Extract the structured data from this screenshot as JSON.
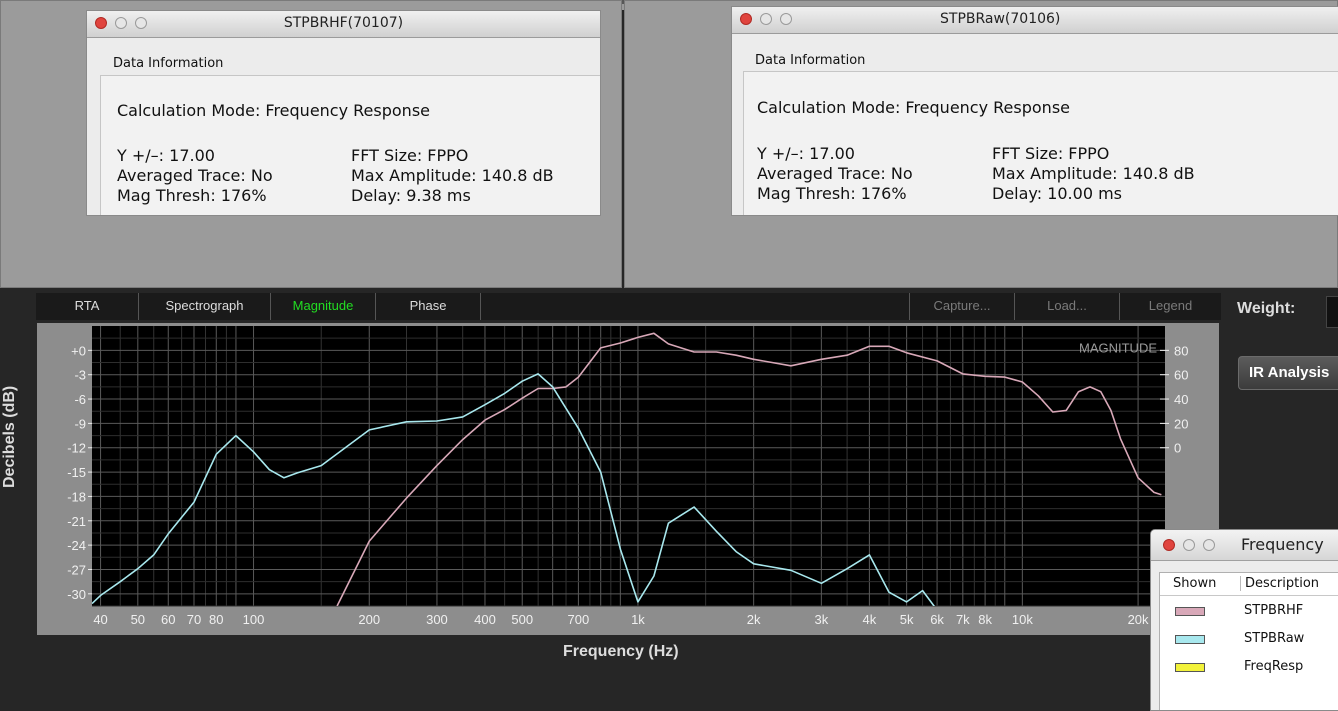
{
  "windows": [
    {
      "title": "STPBRHF(70107)",
      "info_heading": "Data Information",
      "calc_mode": "Calculation Mode: Frequency Response",
      "left_col": [
        "Y +/–: 17.00",
        "Averaged Trace: No",
        "Mag Thresh: 176%"
      ],
      "right_col": [
        "FFT Size: FPPO",
        "Max Amplitude: 140.8 dB",
        "Delay: 9.38 ms"
      ]
    },
    {
      "title": "STPBRaw(70106)",
      "info_heading": "Data Information",
      "calc_mode": "Calculation Mode: Frequency Response",
      "left_col": [
        "Y +/–: 17.00",
        "Averaged Trace: No",
        "Mag Thresh: 176%"
      ],
      "right_col": [
        "FFT Size: FPPO",
        "Max Amplitude: 140.8 dB",
        "Delay: 10.00 ms"
      ]
    }
  ],
  "tabs": [
    "RTA",
    "Spectrograph",
    "Magnitude",
    "Phase"
  ],
  "active_tab": "Magnitude",
  "right_buttons": [
    "Capture...",
    "Load...",
    "Legend"
  ],
  "weight_label": "Weight:",
  "ir_button": "IR Analysis",
  "chart_data": {
    "type": "line",
    "overlay_label": "MAGNITUDE",
    "xlabel": "Frequency (Hz)",
    "ylabel": "Decibels (dB)",
    "x_scale": "log",
    "xlim": [
      38,
      23500
    ],
    "ylim": [
      -31.5,
      3
    ],
    "x_ticks": [
      40,
      50,
      60,
      70,
      80,
      100,
      200,
      300,
      400,
      500,
      700,
      1000,
      2000,
      3000,
      4000,
      5000,
      6000,
      7000,
      8000,
      10000,
      20000
    ],
    "x_tick_labels": [
      "40",
      "50",
      "60",
      "70",
      "80",
      "100",
      "200",
      "300",
      "400",
      "500",
      "700",
      "1k",
      "2k",
      "3k",
      "4k",
      "5k",
      "6k",
      "7k",
      "8k",
      "10k",
      "20k"
    ],
    "y_ticks": [
      0,
      -3,
      -6,
      -9,
      -12,
      -15,
      -18,
      -21,
      -24,
      -27,
      -30
    ],
    "y_tick_labels": [
      "+0",
      "-3",
      "-6",
      "-9",
      "-12",
      "-15",
      "-18",
      "-21",
      "-24",
      "-27",
      "-30"
    ],
    "right_ticks": [
      0,
      -3,
      -6,
      -9,
      -12
    ],
    "right_tick_labels": [
      "80",
      "60",
      "40",
      "20",
      "0"
    ],
    "series": [
      {
        "name": "STPBRHF",
        "color": "#d8a8b8",
        "x": [
          165,
          200,
          250,
          300,
          350,
          400,
          450,
          500,
          550,
          600,
          650,
          700,
          800,
          900,
          1000,
          1100,
          1200,
          1400,
          1600,
          1800,
          2000,
          2500,
          3000,
          3500,
          4000,
          4500,
          5000,
          6000,
          7000,
          8000,
          9000,
          10000,
          11000,
          12000,
          13000,
          14000,
          15000,
          16000,
          17000,
          18000,
          20000,
          22000,
          23000
        ],
        "y": [
          -31.5,
          -23.5,
          -18.2,
          -14.2,
          -11.0,
          -8.6,
          -7.3,
          -5.9,
          -4.7,
          -4.7,
          -4.5,
          -3.3,
          0.3,
          0.9,
          1.6,
          2.1,
          0.8,
          -0.2,
          -0.2,
          -0.6,
          -1.1,
          -1.9,
          -1.1,
          -0.6,
          0.5,
          0.5,
          -0.3,
          -1.3,
          -2.9,
          -3.2,
          -3.3,
          -3.9,
          -5.6,
          -7.6,
          -7.4,
          -5.1,
          -4.5,
          -5.1,
          -7.4,
          -10.9,
          -15.7,
          -17.5,
          -17.8
        ]
      },
      {
        "name": "STPBRaw",
        "color": "#a8e8ee",
        "x": [
          38,
          40,
          45,
          50,
          55,
          60,
          70,
          80,
          90,
          100,
          110,
          120,
          130,
          150,
          200,
          250,
          300,
          350,
          400,
          450,
          500,
          550,
          600,
          700,
          800,
          900,
          1000,
          1100,
          1200,
          1400,
          1600,
          1800,
          2000,
          2500,
          3000,
          3500,
          4000,
          4500,
          5000,
          5500,
          6000
        ],
        "y": [
          -31.2,
          -30.2,
          -28.5,
          -26.9,
          -25.2,
          -22.6,
          -18.7,
          -12.8,
          -10.5,
          -12.5,
          -14.7,
          -15.7,
          -15.1,
          -14.2,
          -9.8,
          -8.8,
          -8.7,
          -8.2,
          -6.7,
          -5.3,
          -3.8,
          -2.9,
          -4.5,
          -9.6,
          -15.0,
          -24.5,
          -31.0,
          -27.8,
          -21.3,
          -19.3,
          -22.3,
          -24.8,
          -26.3,
          -27.1,
          -28.7,
          -26.9,
          -25.2,
          -29.8,
          -31.0,
          -29.6,
          -32.0
        ]
      },
      {
        "name": "FreqResp",
        "color": "#f2f23a",
        "x": [],
        "y": []
      }
    ]
  },
  "legend": {
    "title": "Frequency",
    "col_shown": "Shown",
    "col_description": "Description",
    "rows": [
      {
        "description": "STPBRHF",
        "color": "#d8a8b8"
      },
      {
        "description": "STPBRaw",
        "color": "#a8e8ee"
      },
      {
        "description": "FreqResp",
        "color": "#f2f23a"
      }
    ]
  }
}
